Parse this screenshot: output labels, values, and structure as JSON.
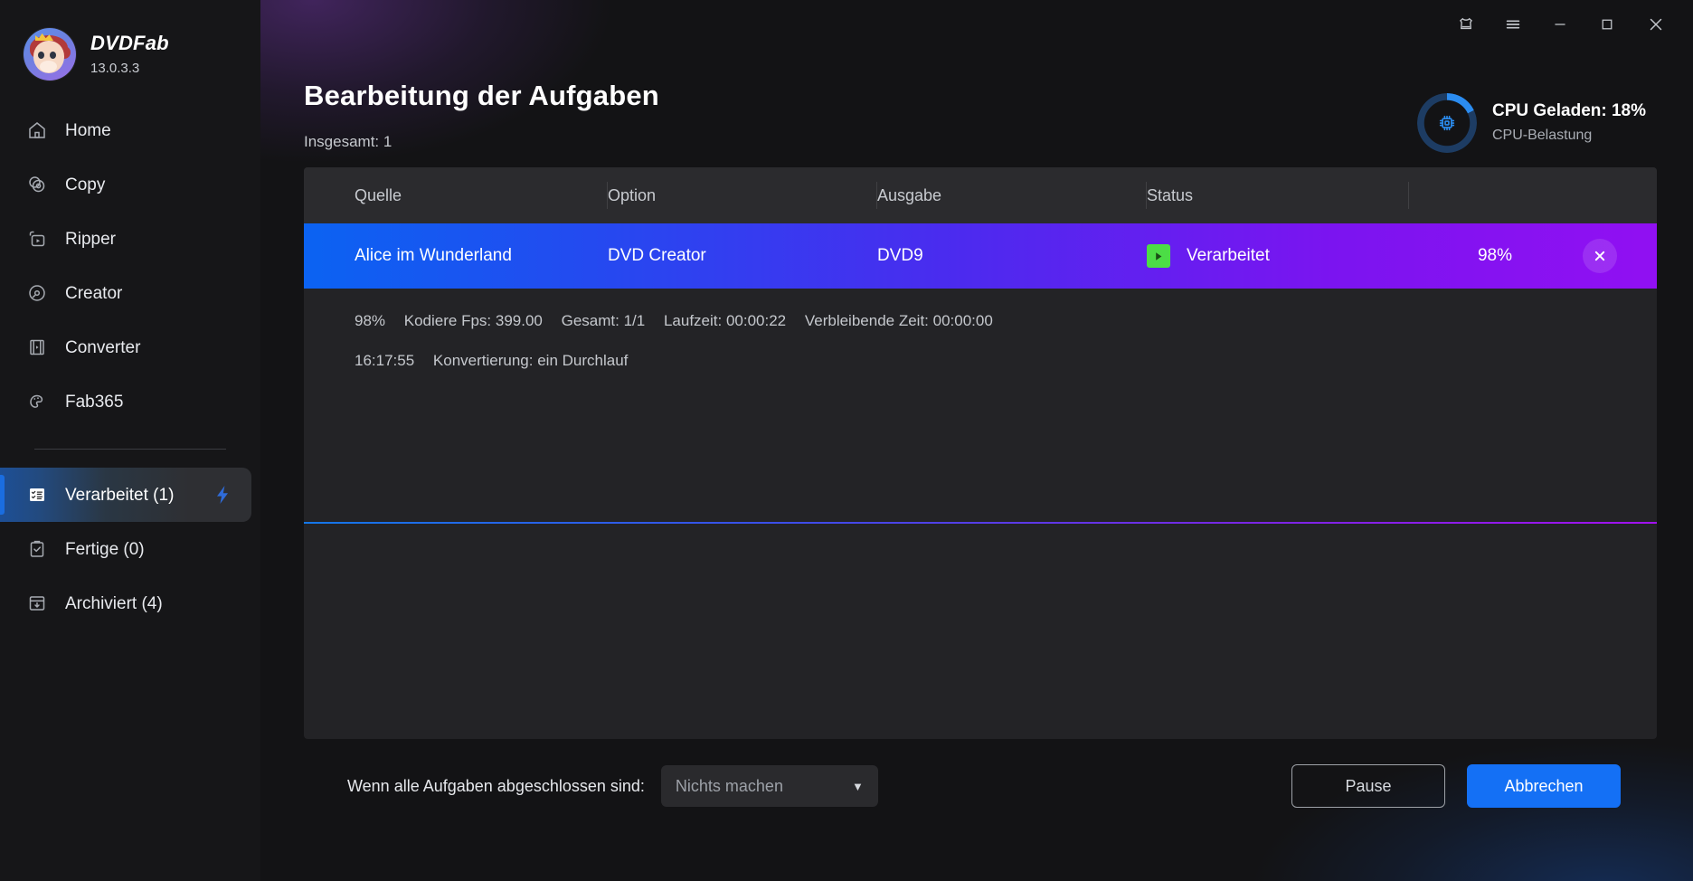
{
  "brand": {
    "name": "DVDFab",
    "version": "13.0.3.3",
    "logo_icon": "monkey-avatar-icon"
  },
  "titlebar": {
    "buttons": [
      {
        "name": "theme-shirt-icon",
        "label": ""
      },
      {
        "name": "menu-hamburger-icon",
        "label": ""
      },
      {
        "name": "minimize-icon",
        "label": ""
      },
      {
        "name": "maximize-icon",
        "label": ""
      },
      {
        "name": "close-icon",
        "label": ""
      }
    ]
  },
  "sidebar": {
    "items": [
      {
        "label": "Home",
        "icon": "home-icon",
        "active": false
      },
      {
        "label": "Copy",
        "icon": "copy-disc-icon",
        "active": false
      },
      {
        "label": "Ripper",
        "icon": "ripper-icon",
        "active": false
      },
      {
        "label": "Creator",
        "icon": "creator-disc-icon",
        "active": false
      },
      {
        "label": "Converter",
        "icon": "converter-film-icon",
        "active": false
      },
      {
        "label": "Fab365",
        "icon": "fab365-icon",
        "active": false
      }
    ],
    "queue_items": [
      {
        "label": "Verarbeitet (1)",
        "icon": "processing-list-icon",
        "active": true,
        "badge": "lightning-bolt-icon"
      },
      {
        "label": "Fertige (0)",
        "icon": "clipboard-check-icon",
        "active": false
      },
      {
        "label": "Archiviert (4)",
        "icon": "archive-box-icon",
        "active": false
      }
    ]
  },
  "header": {
    "title": "Bearbeitung der Aufgaben",
    "total": "Insgesamt: 1"
  },
  "cpu": {
    "title": "CPU Geladen: 18%",
    "subtitle": "CPU-Belastung",
    "percent": 18,
    "accent_color": "#2b8cf0",
    "track_color": "#1d3c63",
    "icon": "cpu-chip-icon"
  },
  "table": {
    "columns": [
      "Quelle",
      "Option",
      "Ausgabe",
      "Status",
      ""
    ],
    "rows": [
      {
        "source": "Alice im Wunderland",
        "option": "DVD Creator",
        "output": "DVD9",
        "status": "Verarbeitet",
        "status_icon": "play-icon",
        "progress": "98%",
        "close_icon": "close-icon",
        "gradient_from": "#0b63f2",
        "gradient_to": "#9110f2"
      }
    ],
    "details": [
      [
        "98%",
        "Kodiere Fps: 399.00",
        "Gesamt: 1/1",
        "Laufzeit: 00:00:22",
        "Verbleibende Zeit: 00:00:00"
      ],
      [
        "16:17:55",
        "Konvertierung: ein Durchlauf"
      ]
    ]
  },
  "footer": {
    "label": "Wenn alle Aufgaben abgeschlossen sind:",
    "select_value": "Nichts machen",
    "caret_icon": "chevron-down-icon",
    "pause_label": "Pause",
    "cancel_label": "Abbrechen",
    "primary_color": "#1470f5"
  }
}
